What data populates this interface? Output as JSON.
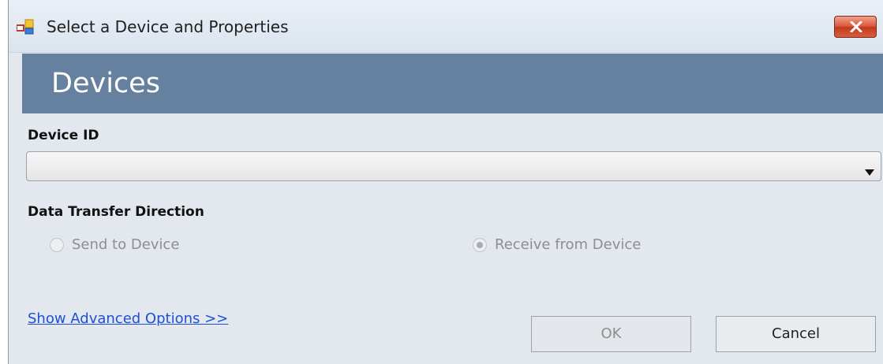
{
  "window": {
    "title": "Select a Device and Properties",
    "icon": "app-window-icon",
    "close_icon": "close-icon"
  },
  "header": {
    "title": "Devices",
    "band_color": "#66809f"
  },
  "device_id": {
    "label": "Device ID",
    "value": "",
    "options": []
  },
  "transfer": {
    "label": "Data Transfer Direction",
    "options": [
      {
        "label": "Send to Device",
        "selected": false,
        "enabled": false
      },
      {
        "label": "Receive from Device",
        "selected": true,
        "enabled": false
      }
    ]
  },
  "footer": {
    "advanced_link": "Show Advanced Options >>",
    "ok_label": "OK",
    "cancel_label": "Cancel"
  },
  "colors": {
    "link": "#1f4fd6",
    "disabled_text": "#8e8e8e",
    "close_button": "#c2391c"
  }
}
